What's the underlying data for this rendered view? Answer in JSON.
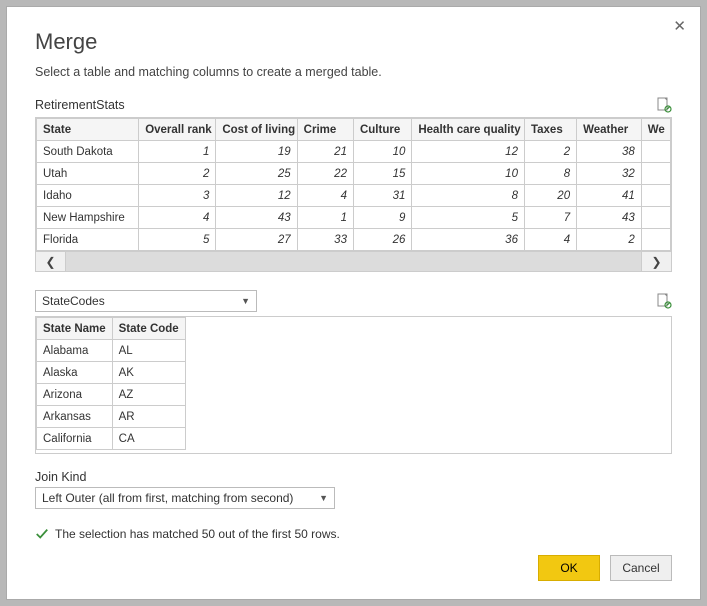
{
  "dialog": {
    "title": "Merge",
    "subtitle": "Select a table and matching columns to create a merged table."
  },
  "table1": {
    "name": "RetirementStats",
    "columns": [
      "State",
      "Overall rank",
      "Cost of living",
      "Crime",
      "Culture",
      "Health care quality",
      "Taxes",
      "Weather",
      "We"
    ],
    "rows": [
      {
        "state": "South Dakota",
        "rank": 1,
        "col": 19,
        "crime": 21,
        "culture": 10,
        "hcq": 12,
        "taxes": 2,
        "weather": 38
      },
      {
        "state": "Utah",
        "rank": 2,
        "col": 25,
        "crime": 22,
        "culture": 15,
        "hcq": 10,
        "taxes": 8,
        "weather": 32
      },
      {
        "state": "Idaho",
        "rank": 3,
        "col": 12,
        "crime": 4,
        "culture": 31,
        "hcq": 8,
        "taxes": 20,
        "weather": 41
      },
      {
        "state": "New Hampshire",
        "rank": 4,
        "col": 43,
        "crime": 1,
        "culture": 9,
        "hcq": 5,
        "taxes": 7,
        "weather": 43
      },
      {
        "state": "Florida",
        "rank": 5,
        "col": 27,
        "crime": 33,
        "culture": 26,
        "hcq": 36,
        "taxes": 4,
        "weather": 2
      }
    ]
  },
  "table2": {
    "selected": "StateCodes",
    "columns": [
      "State Name",
      "State Code"
    ],
    "rows": [
      {
        "name": "Alabama",
        "code": "AL"
      },
      {
        "name": "Alaska",
        "code": "AK"
      },
      {
        "name": "Arizona",
        "code": "AZ"
      },
      {
        "name": "Arkansas",
        "code": "AR"
      },
      {
        "name": "California",
        "code": "CA"
      }
    ]
  },
  "join": {
    "label": "Join Kind",
    "selected": "Left Outer (all from first, matching from second)"
  },
  "status": "The selection has matched 50 out of the first 50 rows.",
  "buttons": {
    "ok": "OK",
    "cancel": "Cancel"
  }
}
